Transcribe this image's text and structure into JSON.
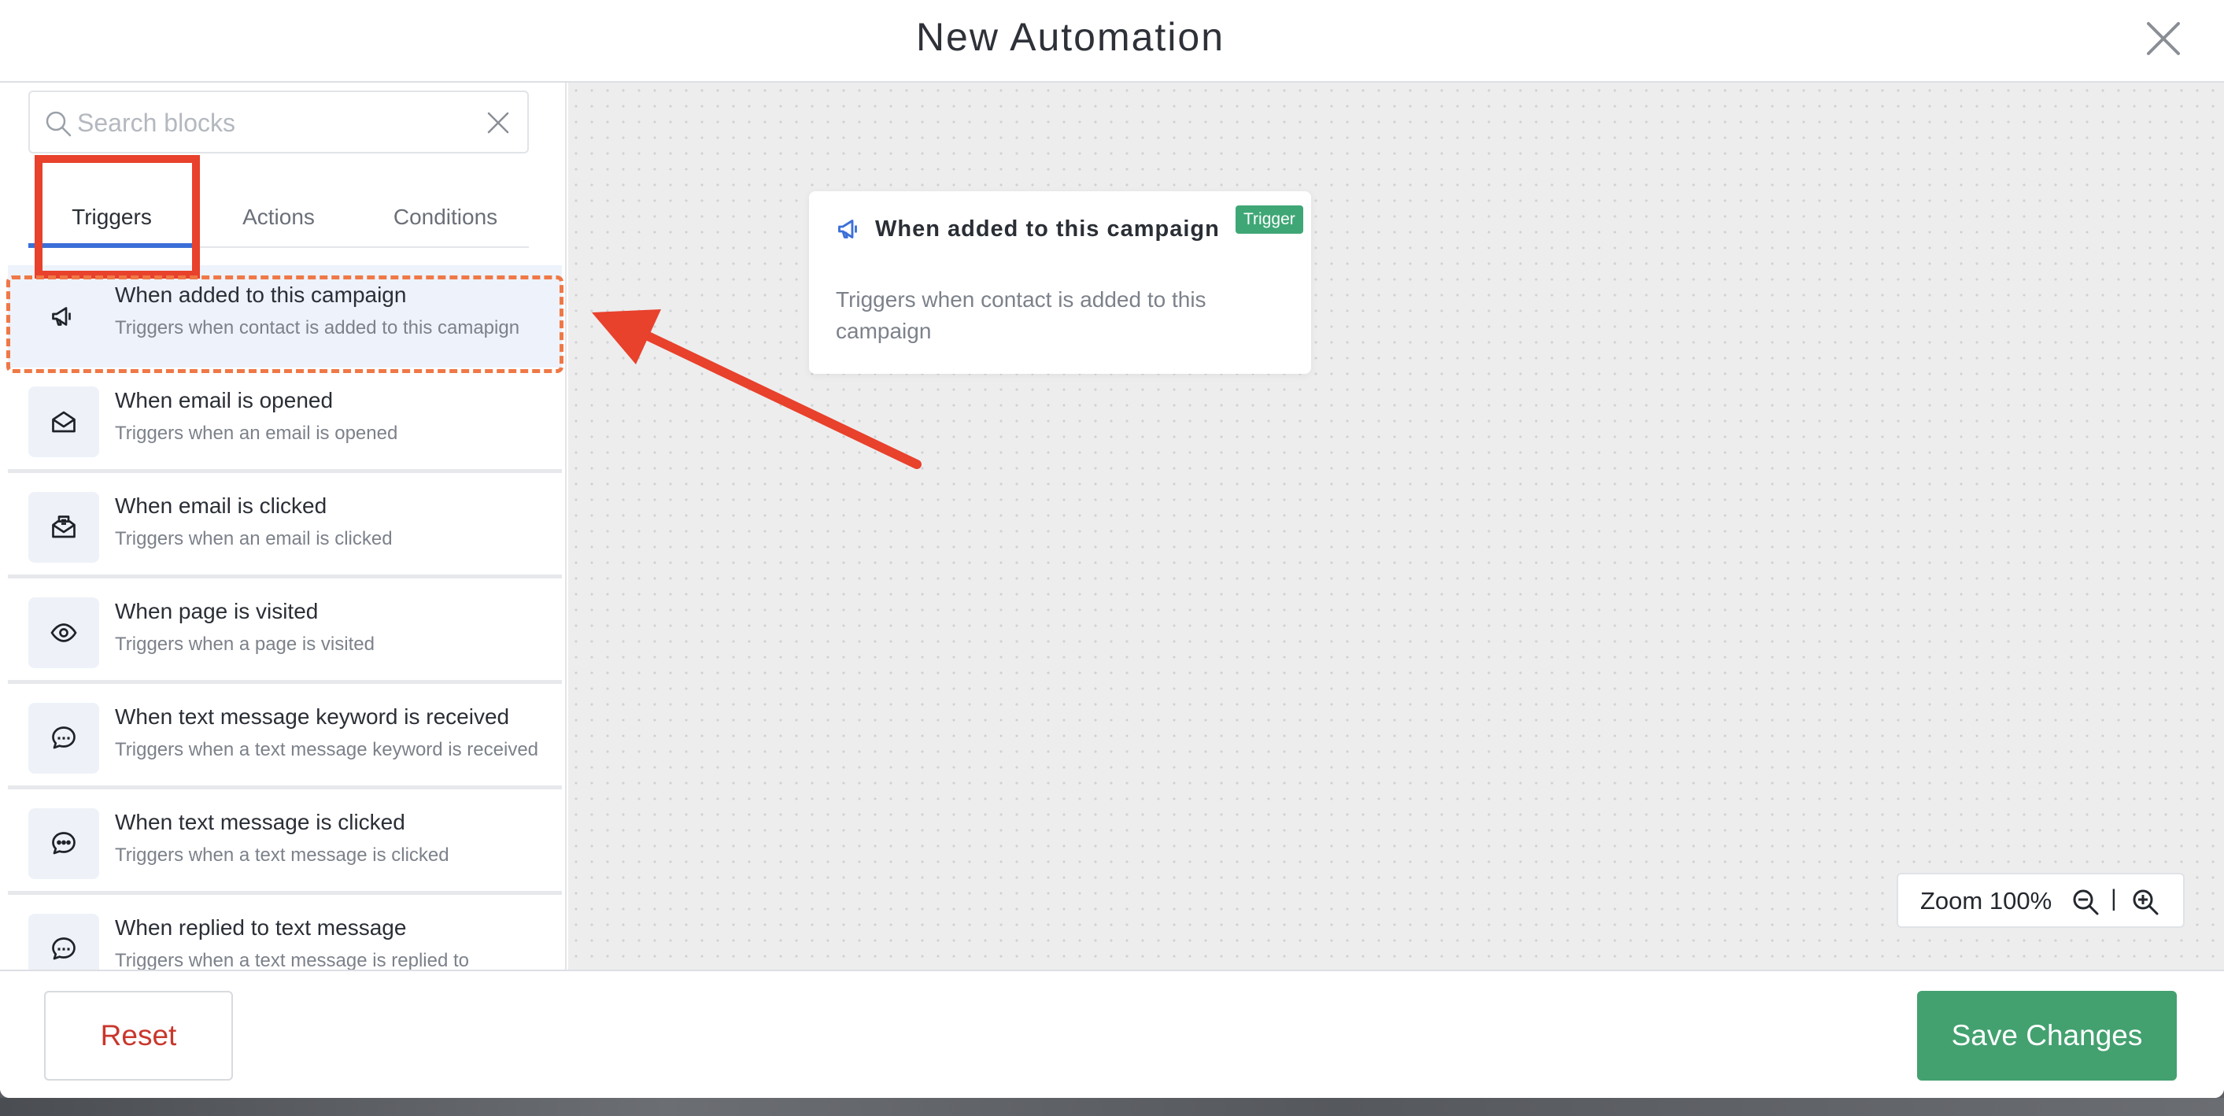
{
  "header": {
    "title": "New Automation"
  },
  "search": {
    "placeholder": "Search blocks"
  },
  "tabs": [
    {
      "label": "Triggers",
      "active": true
    },
    {
      "label": "Actions",
      "active": false
    },
    {
      "label": "Conditions",
      "active": false
    }
  ],
  "triggers": [
    {
      "title": "When added to this campaign",
      "desc": "Triggers when contact is added to this camapign",
      "icon": "megaphone-icon",
      "selected": true
    },
    {
      "title": "When email is opened",
      "desc": "Triggers when an email is opened",
      "icon": "envelope-open-icon"
    },
    {
      "title": "When email is clicked",
      "desc": "Triggers when an email is clicked",
      "icon": "mail-click-icon"
    },
    {
      "title": "When page is visited",
      "desc": "Triggers when a page is visited",
      "icon": "eye-icon"
    },
    {
      "title": "When text message keyword is received",
      "desc": "Triggers when a text message keyword is received",
      "icon": "sms-bubble-icon"
    },
    {
      "title": "When text message is clicked",
      "desc": "Triggers when a text message is clicked",
      "icon": "chat-bubble-icon"
    },
    {
      "title": "When replied to text message",
      "desc": "Triggers when a text message is replied to",
      "icon": "sms-bubble-icon"
    }
  ],
  "node": {
    "title": "When added to this campaign",
    "badge": "Trigger",
    "desc": "Triggers when contact is added to this campaign"
  },
  "zoom": {
    "label": "Zoom 100%",
    "separator": "|"
  },
  "footer": {
    "reset_label": "Reset",
    "save_label": "Save Changes"
  },
  "colors": {
    "accent_blue": "#3b6fd8",
    "save_green": "#43a16f",
    "badge_green": "#3fa776",
    "reset_red": "#c9372c",
    "annotation_red": "#e8412c",
    "annotation_orange": "#ef7846"
  }
}
